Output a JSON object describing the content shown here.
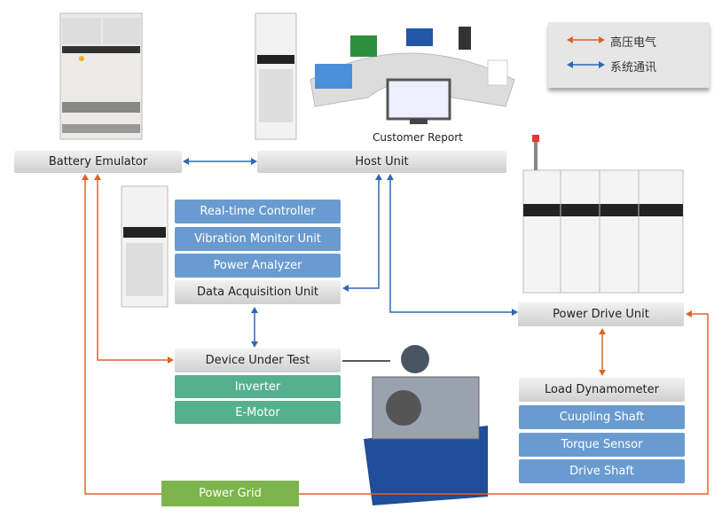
{
  "legend": {
    "items": [
      {
        "label": "高压电气",
        "color": "#e0622a"
      },
      {
        "label": "系统通讯",
        "color": "#2d68b8"
      }
    ]
  },
  "nodes": {
    "battery_emulator": "Battery Emulator",
    "host_unit": "Host Unit",
    "customer_report": "Customer Report",
    "realtime_controller": "Real-time Controller",
    "vibration_monitor": "Vibration Monitor Unit",
    "power_analyzer": "Power Analyzer",
    "data_acquisition": "Data Acquisition Unit",
    "device_under_test": "Device Under Test",
    "inverter": "Inverter",
    "e_motor": "E-Motor",
    "power_drive": "Power Drive Unit",
    "load_dynamometer": "Load Dynamometer",
    "coupling_shaft": "Cuupling Shaft",
    "torque_sensor": "Torque Sensor",
    "drive_shaft": "Drive Shaft",
    "power_grid": "Power Grid"
  },
  "colors": {
    "high_voltage": "#e0622a",
    "communication": "#2d68b8",
    "module_blue": "#6a9bd0",
    "module_green": "#55b08f",
    "power_grid": "#7cb54b"
  }
}
